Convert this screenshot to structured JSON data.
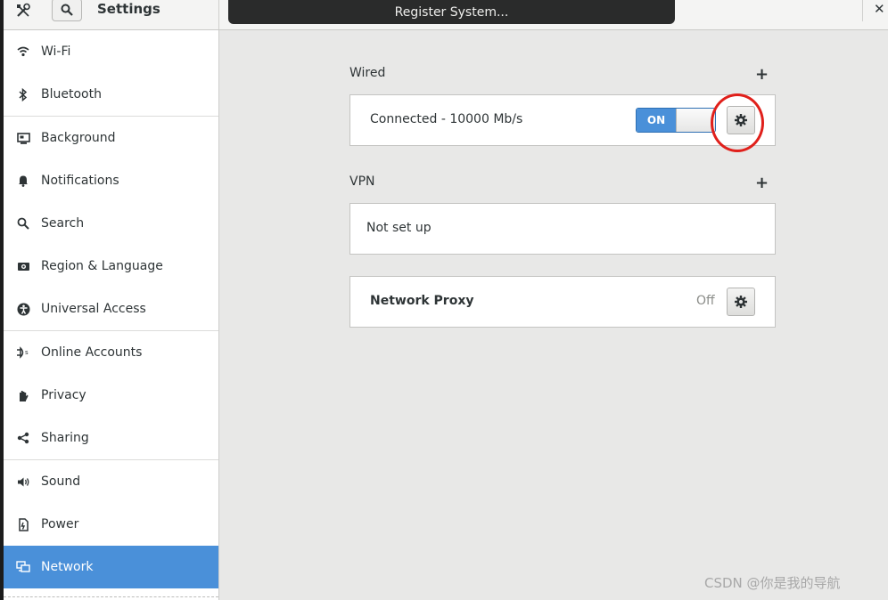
{
  "header": {
    "title": "Settings",
    "banner_text": "Register System...",
    "close_glyph": "✕"
  },
  "sidebar": {
    "items": [
      {
        "label": "Wi-Fi",
        "icon": "wifi-icon"
      },
      {
        "label": "Bluetooth",
        "icon": "bluetooth-icon"
      },
      {
        "label": "Background",
        "icon": "background-icon"
      },
      {
        "label": "Notifications",
        "icon": "bell-icon"
      },
      {
        "label": "Search",
        "icon": "search-icon"
      },
      {
        "label": "Region & Language",
        "icon": "camera-icon"
      },
      {
        "label": "Universal Access",
        "icon": "accessibility-icon"
      },
      {
        "label": "Online Accounts",
        "icon": "online-accounts-icon"
      },
      {
        "label": "Privacy",
        "icon": "hand-icon"
      },
      {
        "label": "Sharing",
        "icon": "share-icon"
      },
      {
        "label": "Sound",
        "icon": "speaker-icon"
      },
      {
        "label": "Power",
        "icon": "power-icon"
      },
      {
        "label": "Network",
        "icon": "network-icon",
        "active": true
      }
    ]
  },
  "main": {
    "wired": {
      "title": "Wired",
      "add_glyph": "+",
      "status": "Connected - 10000 Mb/s",
      "toggle_label": "ON"
    },
    "vpn": {
      "title": "VPN",
      "add_glyph": "+",
      "status": "Not set up"
    },
    "proxy": {
      "title": "Network Proxy",
      "status": "Off"
    }
  },
  "watermark": "CSDN @你是我的导航",
  "colors": {
    "accent": "#4a90d9",
    "annotation": "#e0201b",
    "banner": "#2a2b2b"
  }
}
